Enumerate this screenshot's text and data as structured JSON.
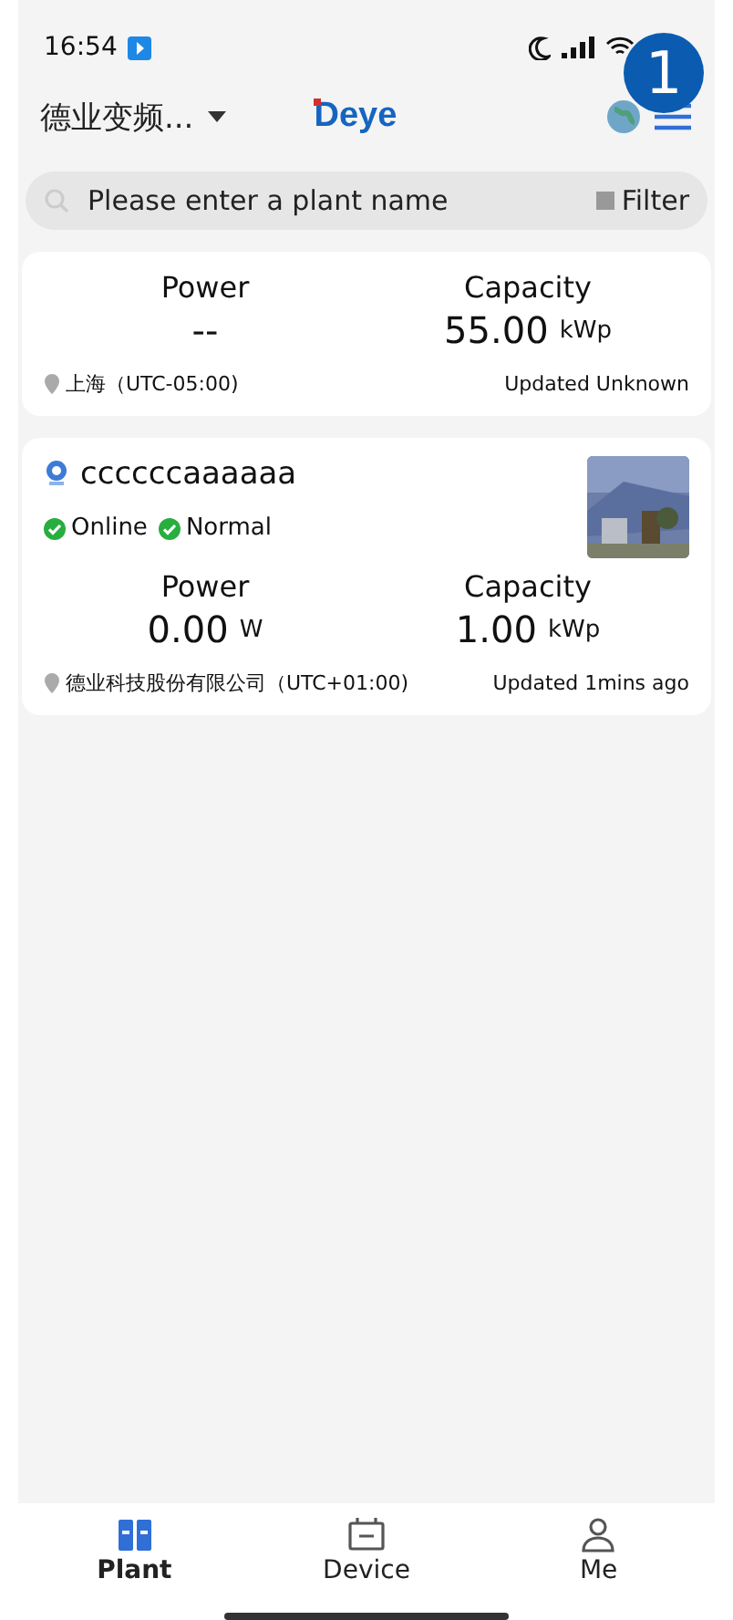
{
  "status_bar": {
    "time": "16:54"
  },
  "header": {
    "site": "德业变频...",
    "logo": "Deye",
    "marker": "1"
  },
  "search": {
    "placeholder": "Please enter a plant name",
    "filter": "Filter"
  },
  "plants": [
    {
      "power_label": "Power",
      "power": "--",
      "capacity_label": "Capacity",
      "capacity": "55.00",
      "capacity_unit": "kWp",
      "location": "上海（UTC-05:00)",
      "updated": "Updated Unknown"
    },
    {
      "name": "ccccccaaaaaa",
      "statuses": [
        {
          "label": "Online",
          "color": "#27ae3f"
        },
        {
          "label": "Normal",
          "color": "#27ae3f"
        }
      ],
      "picture": true,
      "power_label": "Power",
      "power": "0.00",
      "power_unit": "W",
      "capacity_label": "Capacity",
      "capacity": "1.00",
      "capacity_unit": "kWp",
      "location": "德业科技股份有限公司（UTC+01:00)",
      "updated": "Updated 1mins ago"
    }
  ],
  "tabs": [
    {
      "label": "Plant",
      "selected": true
    },
    {
      "label": "Device",
      "selected": false
    },
    {
      "label": "Me",
      "selected": false
    }
  ]
}
